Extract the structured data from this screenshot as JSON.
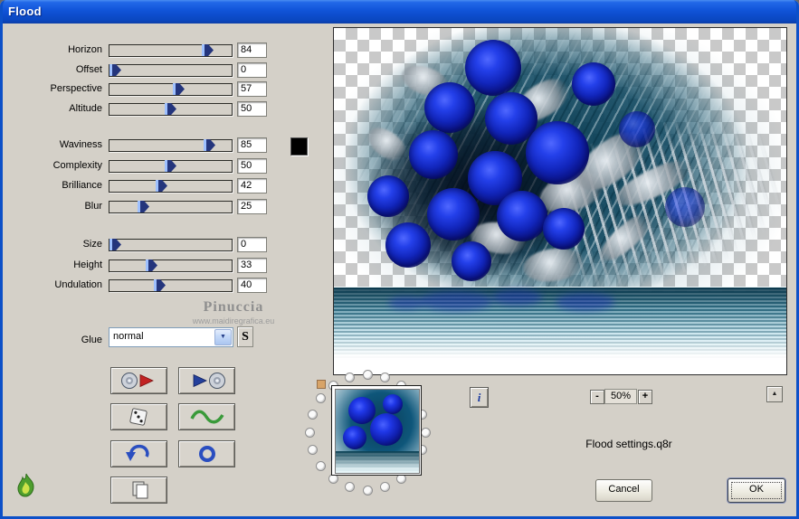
{
  "window": {
    "title": "Flood"
  },
  "sliders": [
    {
      "label": "Horizon",
      "value": 84
    },
    {
      "label": "Offset",
      "value": 0
    },
    {
      "label": "Perspective",
      "value": 57
    },
    {
      "label": "Altitude",
      "value": 50
    },
    {
      "label": "Waviness",
      "value": 85
    },
    {
      "label": "Complexity",
      "value": 50
    },
    {
      "label": "Brilliance",
      "value": 42
    },
    {
      "label": "Blur",
      "value": 25
    },
    {
      "label": "Size",
      "value": 0
    },
    {
      "label": "Height",
      "value": 33
    },
    {
      "label": "Undulation",
      "value": 40
    }
  ],
  "swatch": {
    "color": "#000000"
  },
  "watermark": {
    "name": "Pinuccia",
    "url": "www.maidiregrafica.eu"
  },
  "glue": {
    "label": "Glue",
    "value": "normal",
    "chevron": "▼",
    "s_label": "S"
  },
  "tools": {
    "icons": [
      "cd-load",
      "cd-save",
      "dice",
      "wave",
      "undo",
      "ring",
      "copy"
    ]
  },
  "info_button": {
    "label": "i"
  },
  "zoom": {
    "minus": "-",
    "level": "50%",
    "plus": "+"
  },
  "scroll": {
    "up": "▲"
  },
  "status_text": "Flood settings.q8r",
  "actions": {
    "cancel": "Cancel",
    "ok": "OK"
  },
  "colors": {
    "titlebar_blue": "#1d56d2",
    "dialog_bg": "#d4d0c8",
    "rose_blue": "#1830c8",
    "water_teal": "#0e5a78",
    "swatch_black": "#000000"
  }
}
